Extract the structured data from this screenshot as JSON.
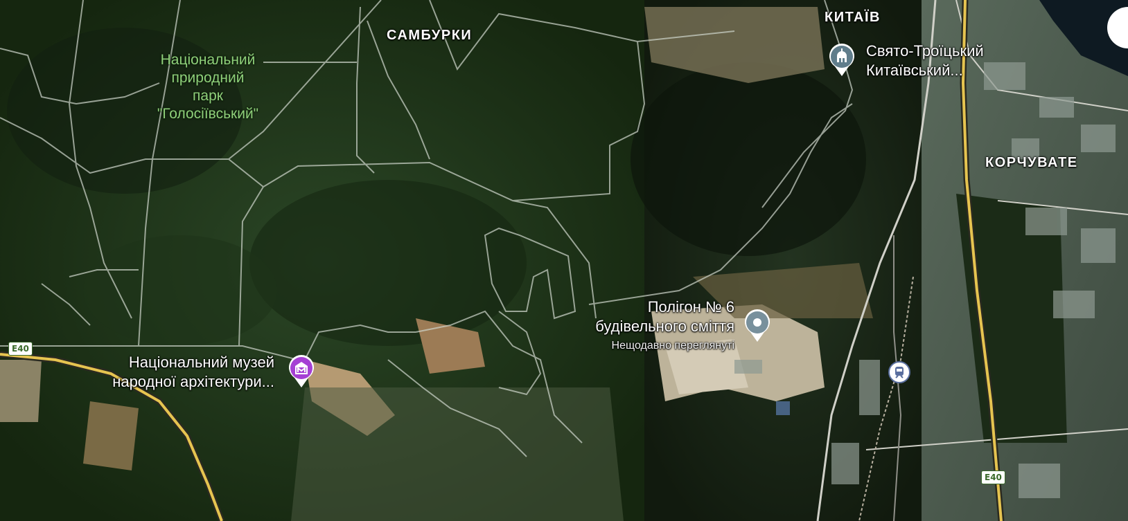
{
  "map": {
    "type": "satellite",
    "districts": [
      "САМБУРКИ",
      "КИТАЇВ",
      "КОРЧУВАТЕ"
    ],
    "park": {
      "line1": "Національний",
      "line2": "природний",
      "line3": "парк",
      "line4": "\"Голосіївський\""
    },
    "poi_museum": {
      "line1": "Національний музей",
      "line2": "народної архітектури...",
      "icon": "museum-icon",
      "color": "#a53fd4"
    },
    "poi_monastery": {
      "line1": "Свято-Троїцький",
      "line2": "Китаївський...",
      "icon": "church-icon",
      "color": "#607d8b"
    },
    "poi_landfill": {
      "line1": "Полігон № 6",
      "line2": "будівельного сміття",
      "sub": "Нещодавно переглянуті",
      "icon": "pin-icon",
      "color": "#78909c"
    },
    "road_shields": [
      "E40",
      "E40"
    ],
    "rail_station_icon": "train-icon"
  }
}
